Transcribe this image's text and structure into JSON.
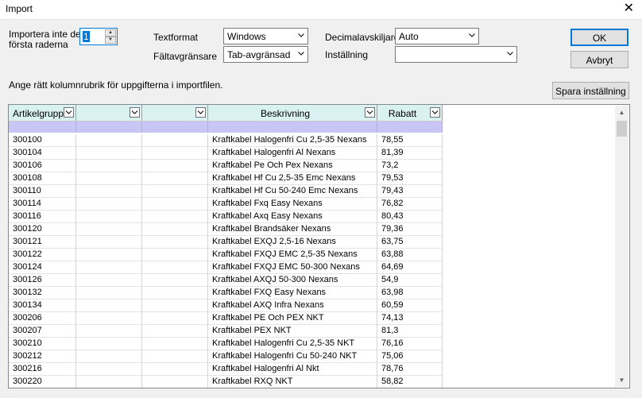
{
  "window": {
    "title": "Import"
  },
  "options": {
    "skip_rows_label_line1": "Importera inte de",
    "skip_rows_label_line2": "första raderna",
    "skip_rows_value": "1",
    "text_format_label": "Textformat",
    "text_format_value": "Windows",
    "field_separator_label": "Fältavgränsare",
    "field_separator_value": "Tab-avgränsad",
    "decimal_separator_label": "Decimalavskiljare",
    "decimal_separator_value": "Auto",
    "setting_label": "Inställning",
    "setting_value": ""
  },
  "buttons": {
    "ok": "OK",
    "cancel": "Avbryt",
    "save_setting": "Spara inställning"
  },
  "instruction": "Ange rätt kolumnrubrik för uppgifterna i importfilen.",
  "grid": {
    "headers": [
      "Artikelgrupp",
      "",
      "",
      "Beskrivning",
      "Rabatt"
    ],
    "rows": [
      [
        "300100",
        "",
        "",
        "Kraftkabel Halogenfri Cu 2,5-35 Nexans",
        "78,55"
      ],
      [
        "300104",
        "",
        "",
        "Kraftkabel Halogenfri Al Nexans",
        "81,39"
      ],
      [
        "300106",
        "",
        "",
        "Kraftkabel Pe Och Pex Nexans",
        "73,2"
      ],
      [
        "300108",
        "",
        "",
        "Kraftkabel Hf Cu 2,5-35 Emc Nexans",
        "79,53"
      ],
      [
        "300110",
        "",
        "",
        "Kraftkabel Hf Cu 50-240 Emc Nexans",
        "79,43"
      ],
      [
        "300114",
        "",
        "",
        "Kraftkabel Fxq Easy Nexans",
        "76,82"
      ],
      [
        "300116",
        "",
        "",
        "Kraftkabel Axq Easy Nexans",
        "80,43"
      ],
      [
        "300120",
        "",
        "",
        "Kraftkabel Brandsäker Nexans",
        "79,36"
      ],
      [
        "300121",
        "",
        "",
        "Kraftkabel EXQJ 2,5-16 Nexans",
        "63,75"
      ],
      [
        "300122",
        "",
        "",
        "Kraftkabel FXQJ EMC 2,5-35 Nexans",
        "63,88"
      ],
      [
        "300124",
        "",
        "",
        "Kraftkabel FXQJ EMC 50-300 Nexans",
        "64,69"
      ],
      [
        "300126",
        "",
        "",
        "Kraftkabel AXQJ 50-300 Nexans",
        "54,9"
      ],
      [
        "300132",
        "",
        "",
        "Kraftkabel FXQ Easy Nexans",
        "63,98"
      ],
      [
        "300134",
        "",
        "",
        "Kraftkabel AXQ Infra Nexans",
        "60,59"
      ],
      [
        "300206",
        "",
        "",
        "Kraftkabel PE Och PEX NKT",
        "74,13"
      ],
      [
        "300207",
        "",
        "",
        "Kraftkabel PEX NKT",
        "81,3"
      ],
      [
        "300210",
        "",
        "",
        "Kraftkabel Halogenfri Cu 2,5-35 NKT",
        "76,16"
      ],
      [
        "300212",
        "",
        "",
        "Kraftkabel Halogenfri Cu 50-240 NKT",
        "75,06"
      ],
      [
        "300216",
        "",
        "",
        "Kraftkabel Halogenfri Al Nkt",
        "78,76"
      ],
      [
        "300220",
        "",
        "",
        "Kraftkabel RXQ NKT",
        "58,82"
      ]
    ]
  },
  "icons": {
    "close": "close-icon",
    "dropdown": "chevron-down-icon",
    "spin_up": "spin-up-icon",
    "spin_down": "spin-down-icon"
  },
  "colors": {
    "header_bg": "#d9f1f1",
    "type_row_bg": "#c9c6f5",
    "accent": "#0078d7"
  }
}
